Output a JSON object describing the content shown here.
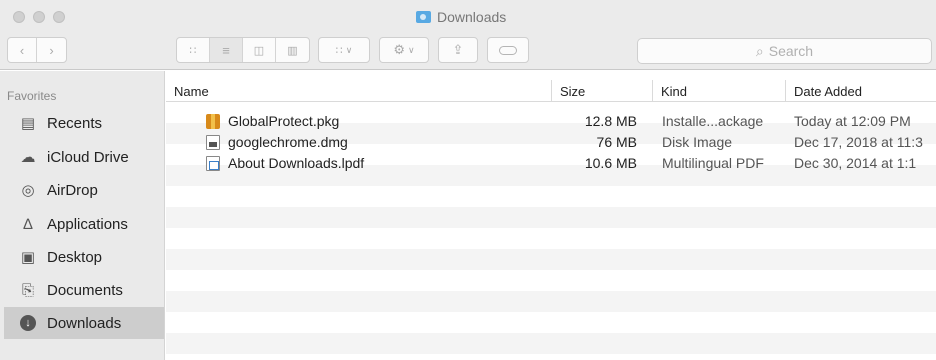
{
  "window": {
    "title": "Downloads"
  },
  "toolbar": {
    "search_placeholder": "Search"
  },
  "sidebar": {
    "header": "Favorites",
    "items": [
      {
        "label": "Recents",
        "icon": "recents-icon"
      },
      {
        "label": "iCloud Drive",
        "icon": "cloud-icon"
      },
      {
        "label": "AirDrop",
        "icon": "airdrop-icon"
      },
      {
        "label": "Applications",
        "icon": "applications-icon"
      },
      {
        "label": "Desktop",
        "icon": "desktop-icon"
      },
      {
        "label": "Documents",
        "icon": "documents-icon"
      },
      {
        "label": "Downloads",
        "icon": "downloads-icon",
        "selected": true
      }
    ]
  },
  "columns": {
    "name": "Name",
    "size": "Size",
    "kind": "Kind",
    "date": "Date Added"
  },
  "files": [
    {
      "name": "GlobalProtect.pkg",
      "size": "12.8 MB",
      "kind": "Installe...ackage",
      "date": "Today at 12:09 PM",
      "icon": "package-icon"
    },
    {
      "name": "googlechrome.dmg",
      "size": "76 MB",
      "kind": "Disk Image",
      "date": "Dec 17, 2018 at 11:3",
      "icon": "disk-image-icon"
    },
    {
      "name": "About Downloads.lpdf",
      "size": "10.6 MB",
      "kind": "Multilingual PDF",
      "date": "Dec 30, 2014 at 1:1",
      "icon": "pdf-icon"
    }
  ],
  "colors": {
    "sidebar_bg": "#eaeaea",
    "selected_bg": "#cdcdcd",
    "stripe": "#f4f4f4",
    "titlebar_bg": "#ebebeb"
  }
}
